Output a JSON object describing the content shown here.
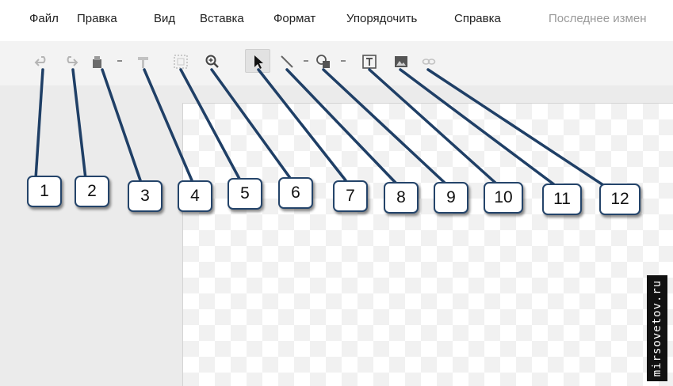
{
  "menu": {
    "items": [
      "Файл",
      "Правка",
      "Вид",
      "Вставка",
      "Формат",
      "Упорядочить",
      "Справка"
    ],
    "last_edit": "Последнее измен"
  },
  "toolbar": {
    "icons": [
      "undo-icon",
      "redo-icon",
      "paint-format-icon",
      "paint-roller-icon",
      "fit-zoom-icon",
      "zoom-icon",
      "select-arrow-icon",
      "line-icon",
      "shape-icon",
      "text-box-icon",
      "image-icon",
      "link-icon"
    ]
  },
  "callouts": [
    "1",
    "2",
    "3",
    "4",
    "5",
    "6",
    "7",
    "8",
    "9",
    "10",
    "11",
    "12"
  ],
  "watermark": "mirsovetov.ru",
  "colors": {
    "callout_border": "#24446a",
    "callout_line": "#1f3f66",
    "toolbar_bg": "#f3f3f3",
    "workspace_bg": "#ebebeb"
  }
}
